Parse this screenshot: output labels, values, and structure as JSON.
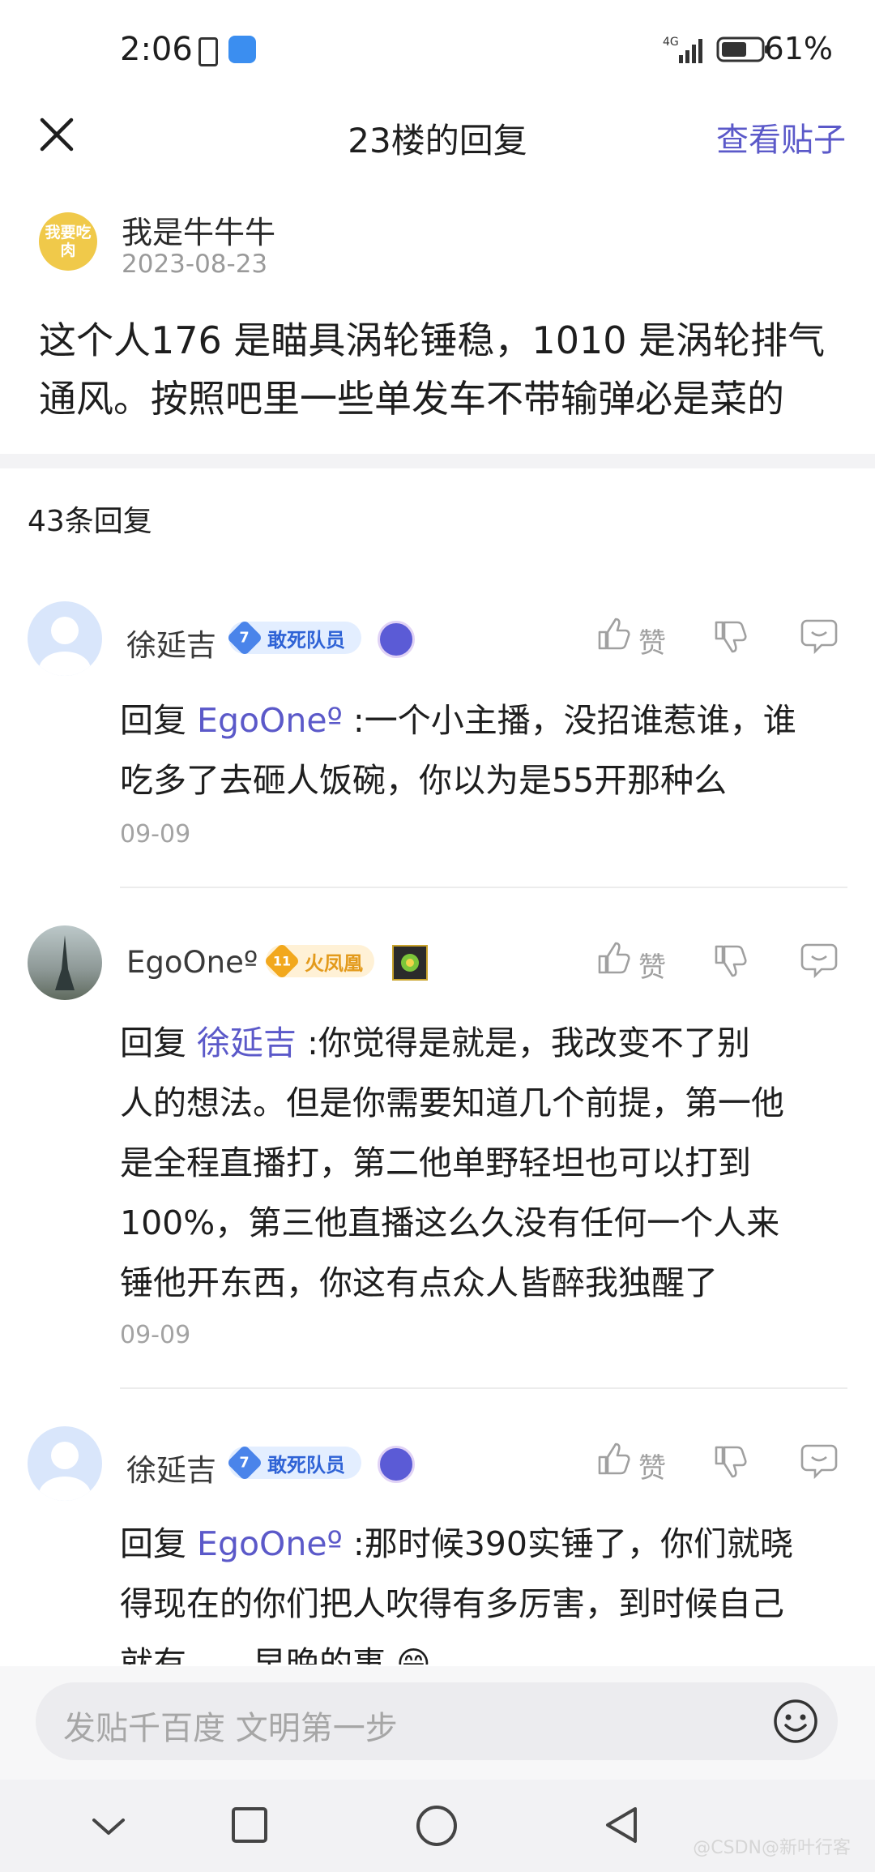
{
  "status_bar": {
    "time": "2:06",
    "network": "4G",
    "battery": "61%"
  },
  "header": {
    "title": "23楼的回复",
    "view_post": "查看贴子"
  },
  "op": {
    "name": "我是牛牛牛",
    "date": "2023-08-23",
    "avatar_text": "我要吃肉",
    "text_line1": "这个人176 是瞄具涡轮锤稳，1010 是涡轮排气",
    "text_line2": "通风。按照吧里一些单发车不带输弹必是菜的"
  },
  "reply_count": "43条回复",
  "actions": {
    "like": "赞"
  },
  "replies": [
    {
      "name": "徐延吉",
      "level": "7",
      "badge": "敢死队员",
      "prefix": "回复 ",
      "mention": "EgoOneº",
      "line1": " :一个小主播，没招谁惹谁，谁",
      "lines": [
        "吃多了去砸人饭碗，你以为是55开那种么"
      ],
      "date": "09-09"
    },
    {
      "name": "EgoOneº",
      "level": "11",
      "badge": "火凤凰",
      "prefix": "回复 ",
      "mention": "徐延吉",
      "line1": " :你觉得是就是，我改变不了别",
      "lines": [
        "人的想法。但是你需要知道几个前提，第一他",
        "是全程直播打，第二他单野轻坦也可以打到",
        "100%，第三他直播这么久没有任何一个人来",
        "锤他开东西，你这有点众人皆醉我独醒了"
      ],
      "date": "09-09"
    },
    {
      "name": "徐延吉",
      "level": "7",
      "badge": "敢死队员",
      "prefix": "回复 ",
      "mention": "EgoOneº",
      "line1": " :那时候390实锤了，你们就晓",
      "lines": [
        "得现在的你们把人吹得有多厉害，到时候自己",
        "就有……早晚的事 😁"
      ],
      "date": ""
    }
  ],
  "input": {
    "placeholder": "发贴千百度 文明第一步"
  },
  "watermark": "@CSDN@新叶行客",
  "colors": {
    "accent": "#5b59c9",
    "badge_blue": "#2f63d6",
    "badge_gold": "#e39a1b"
  },
  "icons": [
    "close-icon",
    "like-icon",
    "dislike-icon",
    "comment-icon",
    "emoji-icon",
    "nav-back-icon",
    "nav-home-icon",
    "nav-recent-icon",
    "nav-collapse-icon"
  ]
}
